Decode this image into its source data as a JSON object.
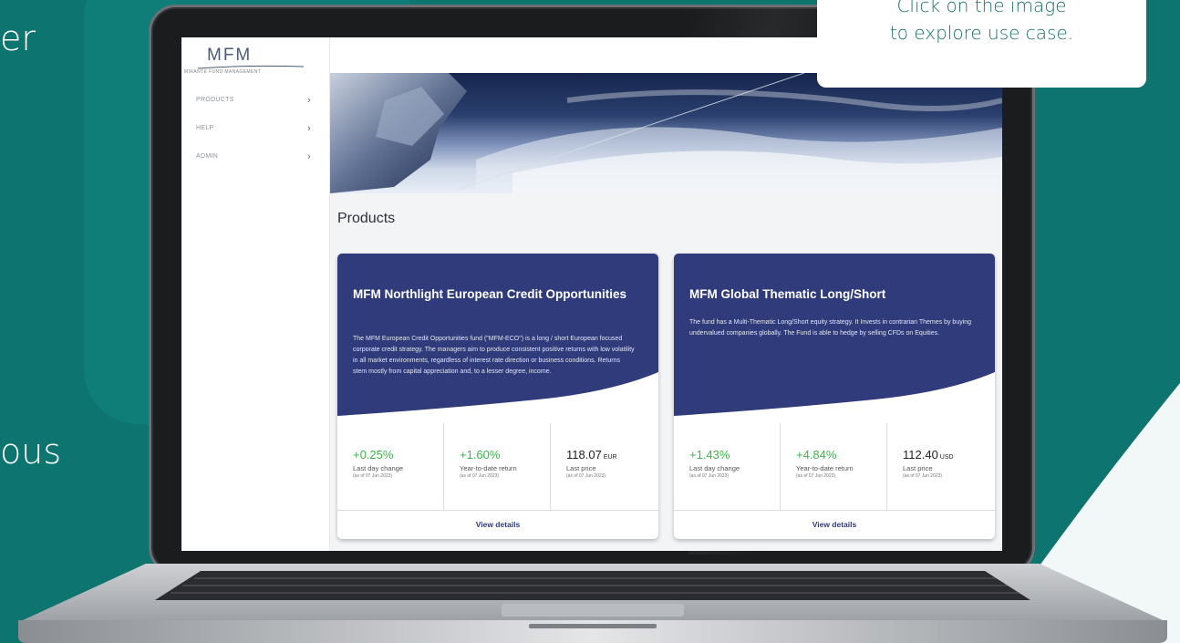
{
  "background": {
    "side_text_1": "er",
    "side_text_2": "ous",
    "teal": "#0d7470"
  },
  "tooltip": {
    "line1": "Click on the image",
    "line2": "to explore use case."
  },
  "app": {
    "logo": "MFM",
    "logo_subtitle": "MIRANTE FUND MANAGEMENT",
    "nav": [
      {
        "label": "PRODUCTS"
      },
      {
        "label": "HELP"
      },
      {
        "label": "ADMIN"
      }
    ],
    "page_title": "Products",
    "cards": [
      {
        "title": "MFM Northlight European Credit Opportunities",
        "description": "The MFM European Credit Opportunities fund (\"MFM-ECO\") is a long / short European focused corporate credit strategy. The managers aim to produce consistent positive returns with low volatility in all market environments, regardless of interest rate direction or business conditions. Returns stem mostly from capital appreciation and, to a lesser degree, income.",
        "day_change": "+0.25%",
        "day_change_label": "Last day change",
        "ytd": "+1.60%",
        "ytd_label": "Year-to-date return",
        "price": "118.07",
        "currency": "EUR",
        "price_label": "Last price",
        "as_of": "(as of 07 Jun 2023)",
        "button": "View details"
      },
      {
        "title": "MFM Global Thematic Long/Short",
        "description": "The fund has a Multi-Thematic Long/Short equity strategy. It Invests in contrarian Themes by buying undervalued companies globally. The Fund is able to hedge by selling CFDs on Equities.",
        "day_change": "+1.43%",
        "day_change_label": "Last day change",
        "ytd": "+4.84%",
        "ytd_label": "Year-to-date return",
        "price": "112.40",
        "currency": "USD",
        "price_label": "Last price",
        "as_of": "(as of 07 Jun 2023)",
        "button": "View details"
      }
    ],
    "colors": {
      "card_header": "#2f3b7a",
      "positive": "#3bb54a"
    }
  }
}
